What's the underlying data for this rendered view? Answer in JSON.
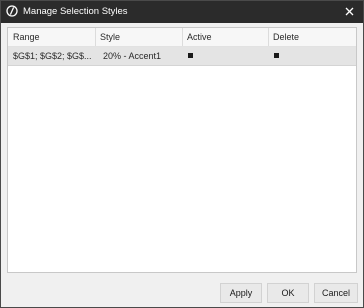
{
  "window": {
    "title": "Manage Selection Styles",
    "app_icon": "app-logo-icon",
    "close_icon": "close-icon"
  },
  "grid": {
    "columns": [
      "Range",
      "Style",
      "Active",
      "Delete"
    ],
    "rows": [
      {
        "range": "$G$1; $G$2; $G$...",
        "style": "20% - Accent1",
        "active": true,
        "delete": true
      }
    ]
  },
  "buttons": {
    "apply": "Apply",
    "ok": "OK",
    "cancel": "Cancel"
  },
  "colors": {
    "titlebar": "#2b2b2b",
    "dialog_bg": "#f0f0f0",
    "row_selected": "#e4e4e4"
  }
}
